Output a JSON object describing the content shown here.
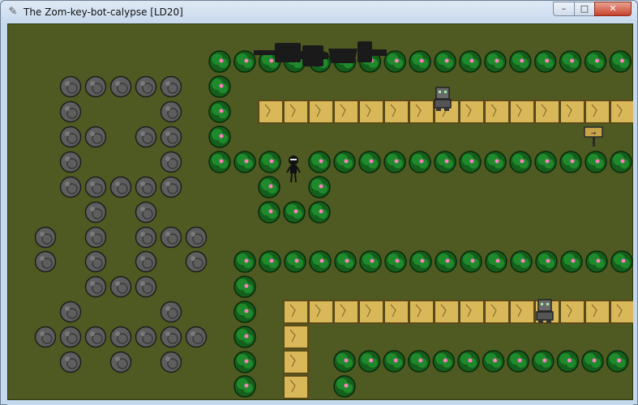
{
  "window": {
    "title": "The Zom-key-bot-calypse [LD20]",
    "icon": "feather-icon",
    "controls": {
      "minimize": "–",
      "maximize": "□",
      "close": "✕"
    }
  },
  "game": {
    "background_color": "#4e5a21",
    "sprites": [
      "bush",
      "rock",
      "sand-tile",
      "robot",
      "player",
      "signpost",
      "machine"
    ],
    "colors": {
      "bush": "#1f8a2b",
      "bush_dark": "#145f1c",
      "berry": "#ff7fbf",
      "rock": "#5e5e5e",
      "rock_dark": "#3a3a3a",
      "tile": "#d9b85a",
      "tile_border": "#5a4a1a",
      "machine": "#1a1a1a",
      "robot": "#6a6a6a",
      "player": "#111111"
    }
  }
}
